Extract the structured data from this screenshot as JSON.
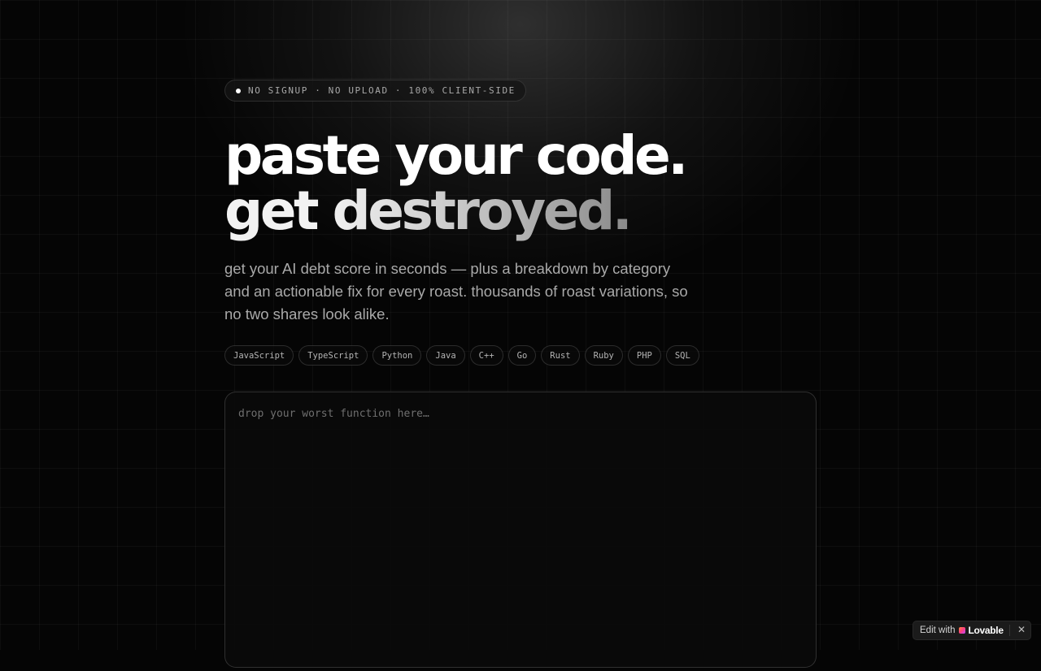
{
  "badge": {
    "text": "NO SIGNUP · NO UPLOAD · 100% CLIENT-SIDE"
  },
  "hero": {
    "line1": "paste your code.",
    "line2_plain": "get ",
    "line2_gradient": "destroyed.",
    "subtitle": "get your AI debt score in seconds — plus a breakdown by category and an actionable fix for every roast. thousands of roast variations, so no two shares look alike."
  },
  "languages": [
    "JavaScript",
    "TypeScript",
    "Python",
    "Java",
    "C++",
    "Go",
    "Rust",
    "Ruby",
    "PHP",
    "SQL"
  ],
  "editor": {
    "placeholder": "drop your worst function here…",
    "value": ""
  },
  "lovable_badge": {
    "edit_label": "Edit with",
    "brand": "Lovable",
    "close_icon": "close-icon"
  },
  "colors": {
    "background": "#050505",
    "text_primary": "#ffffff",
    "text_muted": "#a9a9a9"
  }
}
